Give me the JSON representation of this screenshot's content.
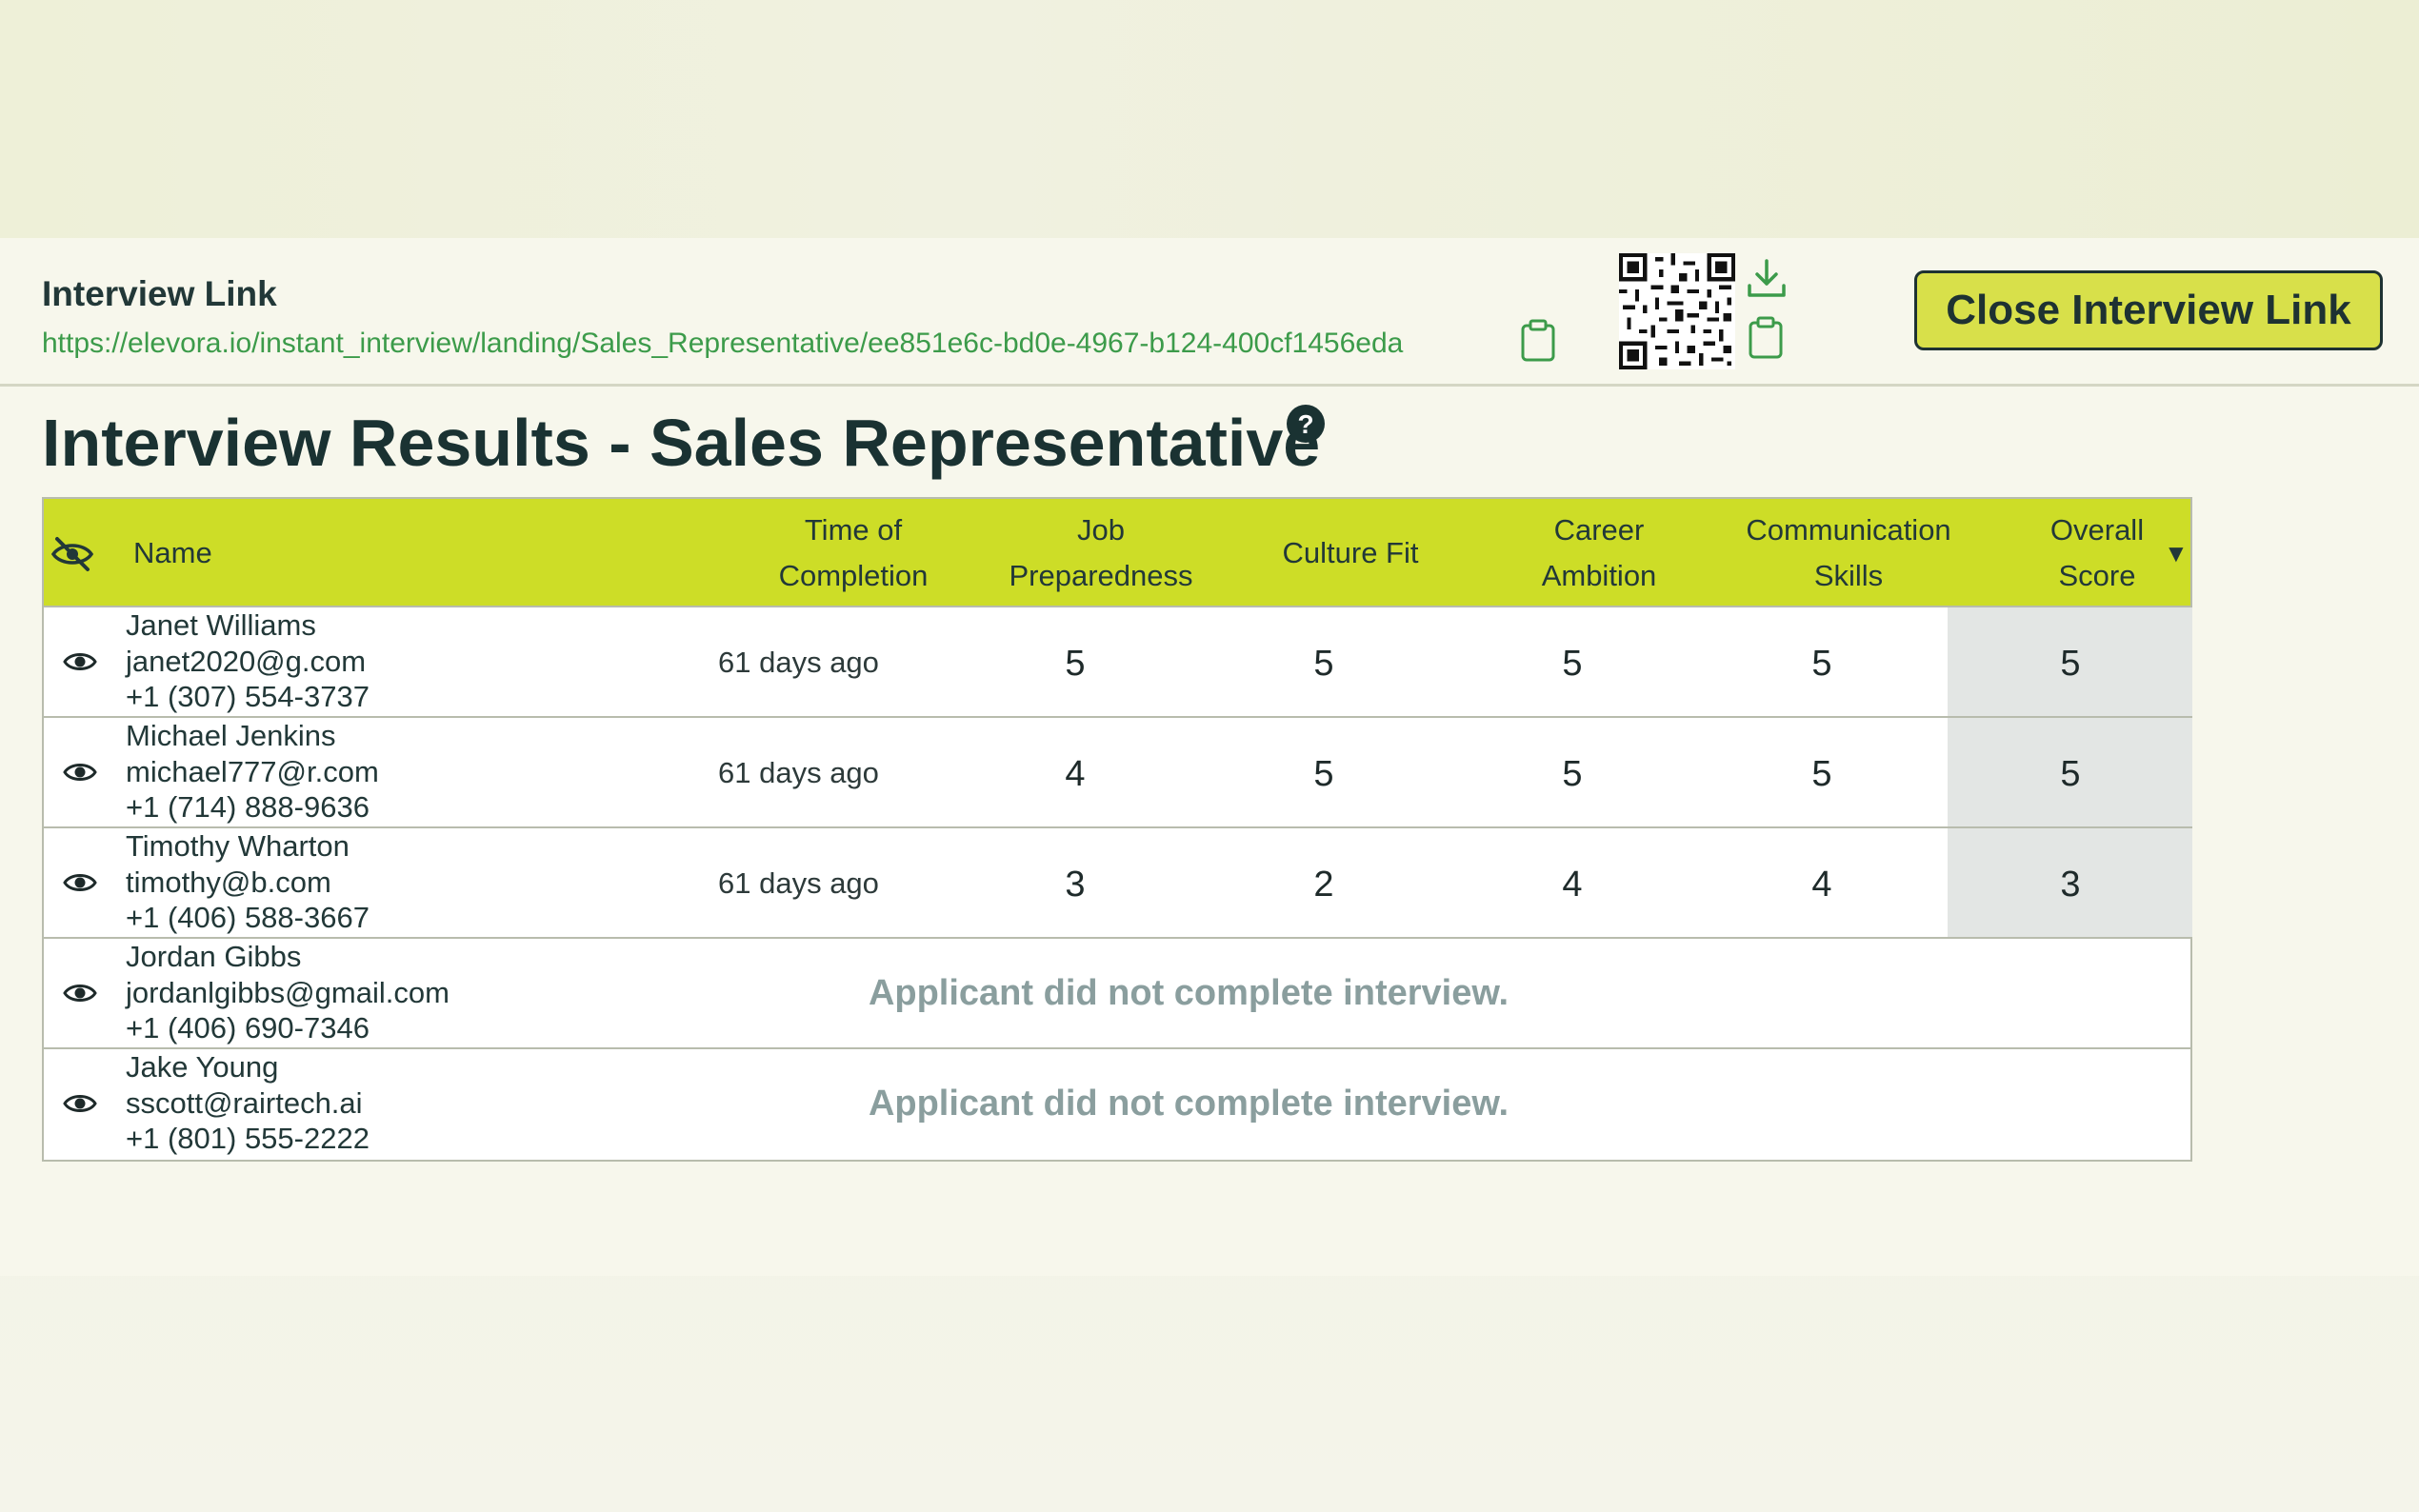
{
  "link": {
    "title": "Interview Link",
    "url": "https://elevora.io/instant_interview/landing/Sales_Representative/ee851e6c-bd0e-4967-b124-400cf1456eda",
    "close_label": "Close Interview Link"
  },
  "page_title": "Interview Results - Sales Representative",
  "table": {
    "headers": {
      "name": "Name",
      "time": [
        "Time of",
        "Completion"
      ],
      "job": [
        "Job",
        "Preparedness"
      ],
      "culture": "Culture Fit",
      "career": [
        "Career",
        "Ambition"
      ],
      "communication": [
        "Communication",
        "Skills"
      ],
      "overall": [
        "Overall",
        "Score"
      ],
      "sort_indicator": "▼"
    },
    "rows": [
      {
        "name": "Janet Williams",
        "email": "janet2020@g.com",
        "phone": "+1 (307) 554-3737",
        "time": "61 days ago",
        "job": "5",
        "culture": "5",
        "career": "5",
        "communication": "5",
        "overall": "5"
      },
      {
        "name": "Michael Jenkins",
        "email": "michael777@r.com",
        "phone": "+1 (714) 888-9636",
        "time": "61 days ago",
        "job": "4",
        "culture": "5",
        "career": "5",
        "communication": "5",
        "overall": "5"
      },
      {
        "name": "Timothy Wharton",
        "email": "timothy@b.com",
        "phone": "+1 (406) 588-3667",
        "time": "61 days ago",
        "job": "3",
        "culture": "2",
        "career": "4",
        "communication": "4",
        "overall": "3"
      },
      {
        "name": "Jordan Gibbs",
        "email": "jordanlgibbs@gmail.com",
        "phone": "+1 (406) 690-7346",
        "status": "Applicant did not complete interview."
      },
      {
        "name": "Jake Young",
        "email": "sscott@rairtech.ai",
        "phone": "+1 (801) 555-2222",
        "status": "Applicant did not complete interview."
      }
    ]
  },
  "colors": {
    "accent": "#cddd27",
    "button": "#d8e04a",
    "link": "#3c9b4a",
    "text": "#1a3232"
  },
  "icons": [
    "clipboard-icon",
    "qr-code",
    "download-icon",
    "help-icon",
    "eye-slash-icon",
    "eye-icon",
    "sort-down-icon"
  ]
}
